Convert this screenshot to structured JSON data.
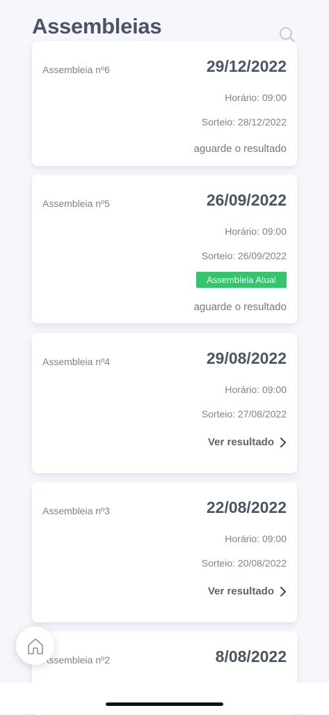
{
  "header": {
    "title": "Assembleias",
    "search_icon": "search-icon"
  },
  "assemblies": [
    {
      "title": "Assembleia nº6",
      "date": "29/12/2022",
      "time": "Horário: 09:00",
      "draw": "Sorteio: 28/12/2022",
      "status": "aguarde o resultado"
    },
    {
      "title": "Assembleia nº5",
      "date": "26/09/2022",
      "time": "Horário: 09:00",
      "draw": "Sorteio: 26/09/2022",
      "badge": "Assembleia Atual",
      "status": "aguarde o resultado"
    },
    {
      "title": "Assembleia nº4",
      "date": "29/08/2022",
      "time": "Horário: 09:00",
      "draw": "Sorteio: 27/08/2022",
      "action": "Ver resultado"
    },
    {
      "title": "Assembleia nº3",
      "date": "22/08/2022",
      "time": "Horário: 09:00",
      "draw": "Sorteio: 20/08/2022",
      "action": "Ver resultado"
    },
    {
      "title": "Assembleia nº2",
      "date": "8/08/2022"
    }
  ],
  "colors": {
    "badge_green": "#34c46e",
    "text_dark": "#4a5563",
    "text_muted": "#7a838e",
    "background": "#f5f7fb"
  },
  "fab": {
    "icon": "home-icon"
  }
}
